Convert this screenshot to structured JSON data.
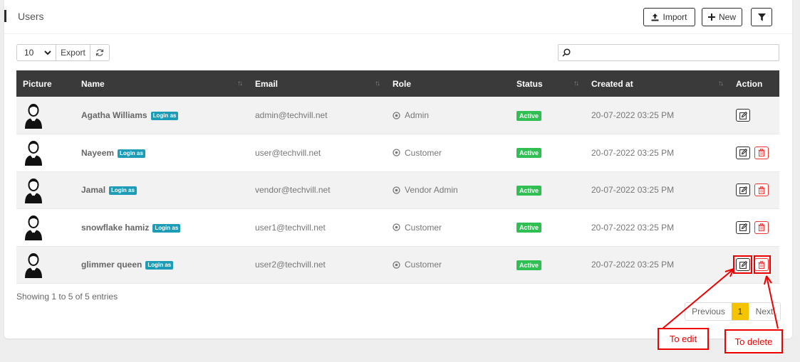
{
  "header": {
    "title": "Users",
    "import_label": "Import",
    "new_label": "New"
  },
  "toolbar": {
    "page_size": "10",
    "export_label": "Export",
    "search_value": ""
  },
  "table": {
    "columns": [
      "Picture",
      "Name",
      "Email",
      "Role",
      "Status",
      "Created at",
      "Action"
    ],
    "login_label": "Login as",
    "rows": [
      {
        "name": "Agatha Williams",
        "email": "admin@techvill.net",
        "role": "Admin",
        "status": "Active",
        "created": "20-07-2022 03:25 PM",
        "deletable": false
      },
      {
        "name": "Nayeem",
        "email": "user@techvill.net",
        "role": "Customer",
        "status": "Active",
        "created": "20-07-2022 03:25 PM",
        "deletable": true
      },
      {
        "name": "Jamal",
        "email": "vendor@techvill.net",
        "role": "Vendor Admin",
        "status": "Active",
        "created": "20-07-2022 03:25 PM",
        "deletable": true
      },
      {
        "name": "snowflake hamiz",
        "email": "user1@techvill.net",
        "role": "Customer",
        "status": "Active",
        "created": "20-07-2022 03:25 PM",
        "deletable": true
      },
      {
        "name": "glimmer queen",
        "email": "user2@techvill.net",
        "role": "Customer",
        "status": "Active",
        "created": "20-07-2022 03:25 PM",
        "deletable": true
      }
    ]
  },
  "footer": {
    "info": "Showing 1 to 5 of 5 entries",
    "prev_label": "Previous",
    "current_page": "1",
    "next_label": "Next"
  },
  "annotations": {
    "edit_note": "To edit",
    "delete_note": "To delete"
  },
  "colors": {
    "accent": "#f5c400",
    "active": "#2fbf53",
    "login": "#1c9cb7",
    "annotation": "#e00000"
  }
}
